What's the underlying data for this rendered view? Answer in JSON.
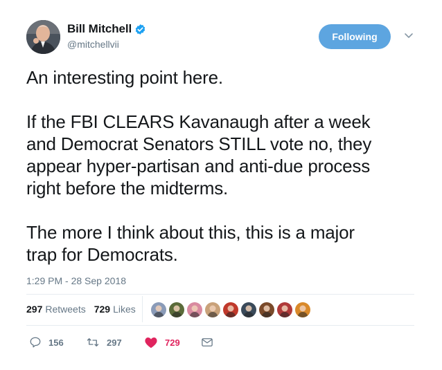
{
  "author": {
    "display_name": "Bill Mitchell",
    "handle": "@mitchellvii",
    "verified": true
  },
  "follow_button": {
    "label": "Following"
  },
  "tweet": {
    "paragraphs": [
      "An interesting point here.",
      "If the FBI CLEARS Kavanaugh after a week\nand Democrat Senators STILL vote no, they\nappear hyper-partisan and anti-due process\nright before the midterms.",
      "The more I think about this, this is a major\ntrap for Democrats."
    ],
    "timestamp": "1:29 PM - 28 Sep 2018"
  },
  "stats": {
    "retweets": {
      "count": "297",
      "label": "Retweets"
    },
    "likes": {
      "count": "729",
      "label": "Likes"
    }
  },
  "liker_avatars": [
    {
      "icon": "liker-avatar-icon",
      "color": "#8a9bb8"
    },
    {
      "icon": "liker-avatar-icon",
      "color": "#5b6b3a"
    },
    {
      "icon": "liker-avatar-icon",
      "color": "#d98aa0"
    },
    {
      "icon": "liker-avatar-icon",
      "color": "#c9a27a"
    },
    {
      "icon": "liker-avatar-icon",
      "color": "#c0392b"
    },
    {
      "icon": "liker-avatar-icon",
      "color": "#3a4a5a"
    },
    {
      "icon": "liker-avatar-icon",
      "color": "#7a4a2a"
    },
    {
      "icon": "liker-avatar-icon",
      "color": "#b03a3a"
    },
    {
      "icon": "liker-avatar-icon",
      "color": "#d9892a"
    }
  ],
  "actions": {
    "reply": {
      "icon": "reply-icon",
      "count": "156"
    },
    "retweet": {
      "icon": "retweet-icon",
      "count": "297"
    },
    "like": {
      "icon": "heart-icon",
      "count": "729",
      "active": true,
      "color": "#e0245e"
    },
    "message": {
      "icon": "envelope-icon"
    }
  },
  "colors": {
    "follow_button_bg": "#5da5e0",
    "verified_badge": "#1da1f2",
    "secondary_text": "#657786",
    "like_active": "#e0245e",
    "divider": "#e6ecf0"
  }
}
